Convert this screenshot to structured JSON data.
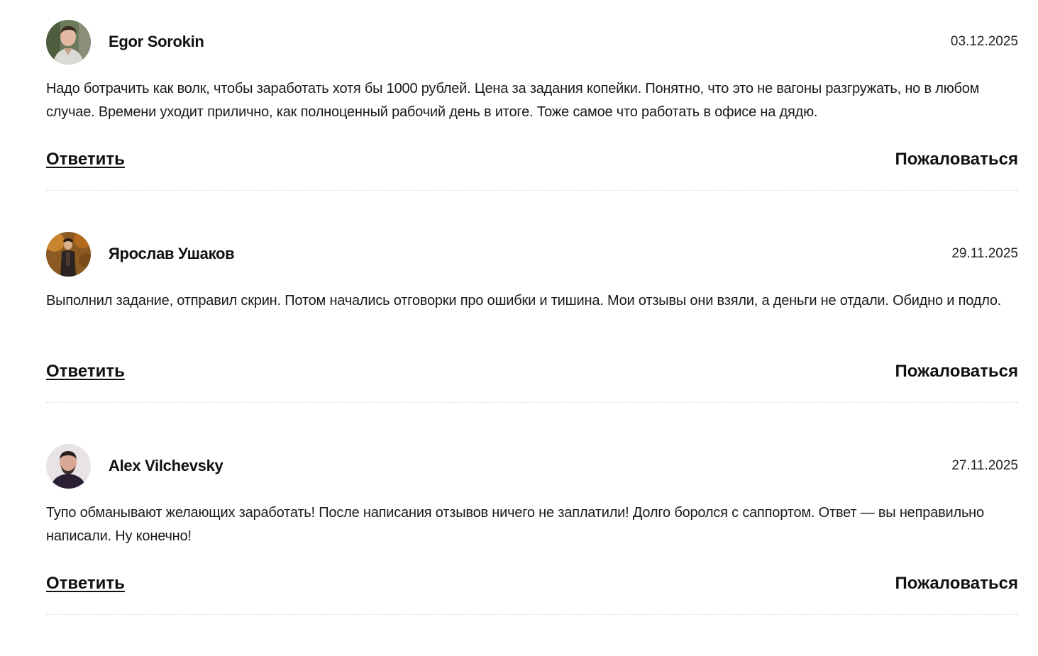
{
  "comments": [
    {
      "author": "Egor Sorokin",
      "date": "03.12.2025",
      "text": "Надо ботрачить как волк, чтобы заработать хотя бы 1000 рублей. Цена за задания копейки. Понятно, что это не вагоны разгружать, но в любом случае. Времени уходит прилично, как полноценный рабочий день в итоге. Тоже самое что работать в офисе на дядю.",
      "reply_label": "Ответить",
      "report_label": "Пожаловаться",
      "avatar_icon": "user-photo-avatar"
    },
    {
      "author": "Ярослав Ушаков",
      "date": "29.11.2025",
      "text": "Выполнил задание, отправил скрин. Потом начались отговорки про ошибки и тишина. Мои отзывы они взяли, а деньги не отдали. Обидно и подло.",
      "reply_label": "Ответить",
      "report_label": "Пожаловаться",
      "avatar_icon": "user-photo-avatar"
    },
    {
      "author": "Alex Vilchevsky",
      "date": "27.11.2025",
      "text": "Тупо обманывают желающих заработать! После написания отзывов ничего не заплатили! Долго боролся с саппортом. Ответ — вы неправильно написали. Ну конечно!",
      "reply_label": "Ответить",
      "report_label": "Пожаловаться",
      "avatar_icon": "user-photo-avatar"
    }
  ],
  "colors": {
    "text": "#1a1a1a",
    "divider": "#e2e2e2",
    "background": "#ffffff"
  }
}
